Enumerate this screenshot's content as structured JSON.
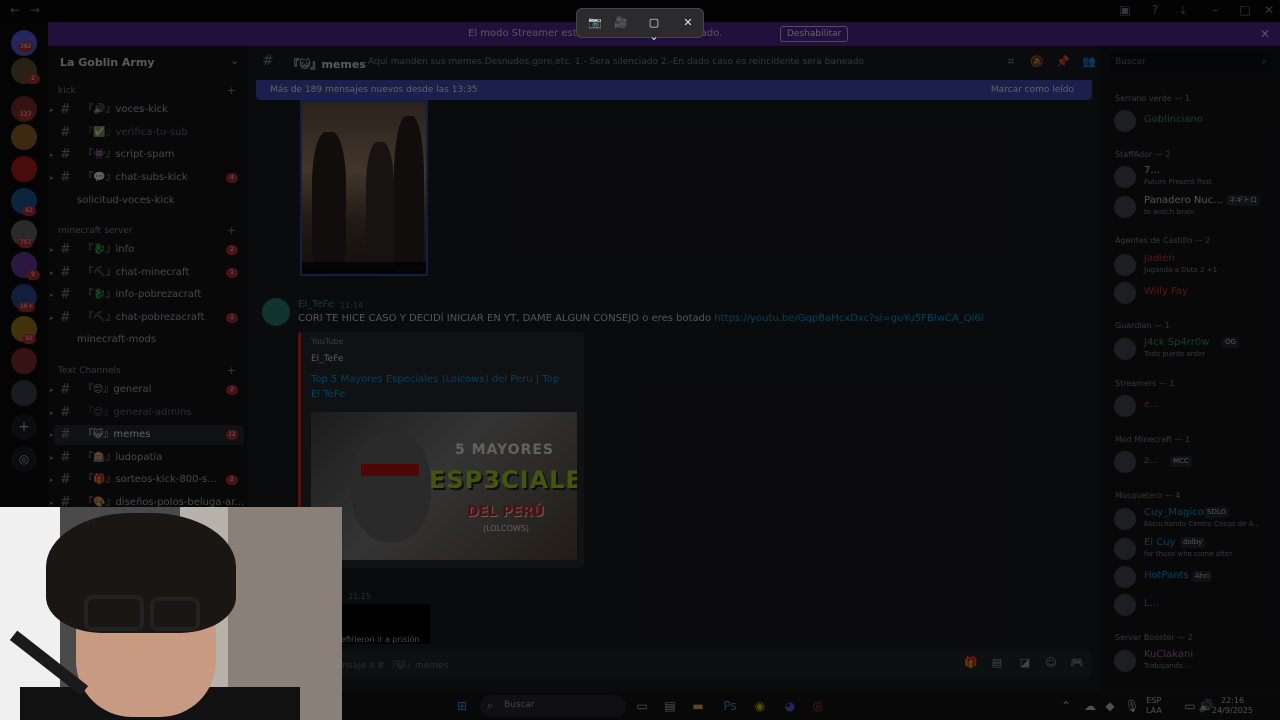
{
  "banner": {
    "text_left": "El modo Streamer está hab",
    "text_right": "se han truncado.",
    "button": "Deshabilitar",
    "close": "✕"
  },
  "snip": {
    "camera": "📷",
    "video": "🎥",
    "mode": "▢ ⌄",
    "close": "✕"
  },
  "rail": {
    "badges": [
      "382",
      "2",
      "127",
      "",
      "",
      "",
      "62",
      "707",
      "9",
      "1K+",
      "92",
      "",
      ""
    ]
  },
  "server": {
    "name": "La Goblin Army",
    "dropdown": "⌄"
  },
  "categories": {
    "kick": "kick",
    "minecraft": "minecraft server",
    "text": "Text Channels",
    "collapse": "›",
    "plus": "+"
  },
  "channels": [
    {
      "name": "『🔊』voces-kick",
      "count": ""
    },
    {
      "name": "『✅』verifica-tu-sub",
      "count": ""
    },
    {
      "name": "『👾』script-spam",
      "count": ""
    },
    {
      "name": "『💬』chat-subs-kick",
      "count": "4"
    },
    {
      "name": "solicitud-voces-kick",
      "count": ""
    },
    {
      "name": "『🐉』info",
      "count": "2"
    },
    {
      "name": "『⛏』chat-minecraft",
      "count": "1"
    },
    {
      "name": "『🐉』info-pobrezacraft",
      "count": "1"
    },
    {
      "name": "『⛏』chat-pobrezacraft",
      "count": "1"
    },
    {
      "name": "minecraft-mods",
      "count": ""
    },
    {
      "name": "『😊』general",
      "count": "2"
    },
    {
      "name": "『😊』general-admins",
      "count": ""
    },
    {
      "name": "『😺』memes",
      "count": "12"
    },
    {
      "name": "『🎰』ludopatia",
      "count": ""
    },
    {
      "name": "『🎁』sorteos-kick-800-s...",
      "count": "2"
    },
    {
      "name": "『🎨』diseños-polos-beluga-ar...",
      "count": ""
    }
  ],
  "header": {
    "channel": "『😺』memes",
    "topic": "Aqui manden sus memes.Desnudos,gore,etc. 1.- Sera silenciado 2.-En dado caso es reincidente sera baneado",
    "search_placeholder": "Buscar"
  },
  "new_messages": {
    "text": "Más de 189 mensajes nuevos desde las 13:35",
    "action": "Marcar como leído"
  },
  "message": {
    "author": "El_TeFe",
    "time": "21:14",
    "text": "CORI TE HICE CASO Y DECIDÍ INICIAR EN YT, DAME ALGUN CONSEJO o eres botado ",
    "link": "https://youtu.be/GqpBaHcxDxc?si=guYu5FBIwCA_Qi6l",
    "embed": {
      "provider": "YouTube",
      "author": "El_TeFe",
      "title": "Top 5 Mayores Especiales (Lolcows) del Peru | Top El TeFe",
      "thumb_line1": "5 MAYORES",
      "thumb_line2": "ESP3CIALES",
      "thumb_line3": "DEL PERÚ",
      "thumb_line4": "(LOLCOWS)"
    }
  },
  "message2": {
    "time": "21:15",
    "text": "efirieron ir a prisión"
  },
  "composer": {
    "placeholder": "nsaje a # 『😺』memes"
  },
  "members": [
    {
      "role": "Serrano verde — 1",
      "items": [
        {
          "name": "Goblinciano",
          "status": "",
          "color": "#3ba55d",
          "tag": ""
        }
      ]
    },
    {
      "role": "StaffAdor — 2",
      "items": [
        {
          "name": "7...",
          "status": "Future Present Past",
          "color": "#dcddde",
          "tag": ""
        },
        {
          "name": "Panadero Nuc...",
          "status": "to watch brain",
          "color": "#dcddde",
          "tag": "ネギトロ"
        }
      ]
    },
    {
      "role": "Agentes de Castillo — 2",
      "items": [
        {
          "name": "Jadien",
          "status": "Jugando a Dota 2 +1",
          "color": "#e03c3c",
          "tag": ""
        },
        {
          "name": "Willy Fay",
          "status": "",
          "color": "#e03c3c",
          "tag": ""
        }
      ]
    },
    {
      "role": "Guardian — 1",
      "items": [
        {
          "name": "J4ck Sp4rr0w",
          "status": "Todo puede arder",
          "color": "#3ba55d",
          "tag": "OG"
        }
      ]
    },
    {
      "role": "Streamers — 1",
      "items": [
        {
          "name": "e...",
          "status": "",
          "color": "#e03c3c",
          "tag": ""
        }
      ]
    },
    {
      "role": "Mod Minecraft — 1",
      "items": [
        {
          "name": "z...",
          "status": "",
          "color": "#3ba55d",
          "tag": "MCC"
        }
      ]
    },
    {
      "role": "Mosquetero — 4",
      "items": [
        {
          "name": "Cuy_Magico",
          "status": "Escuchando Centro Cosqo de A...",
          "color": "#00a8fc",
          "tag": "SDLG"
        },
        {
          "name": "El Cuy",
          "status": "for those who come after",
          "color": "#00a8fc",
          "tag": "dolby"
        },
        {
          "name": "HotPants",
          "status": "",
          "color": "#00a8fc",
          "tag": "Ahri"
        },
        {
          "name": "L...",
          "status": "",
          "color": "#00a8fc",
          "tag": ""
        }
      ]
    },
    {
      "role": "Server Booster — 2",
      "items": [
        {
          "name": "KuClakani",
          "status": "Trabajando...",
          "color": "#d65fd6",
          "tag": ""
        }
      ]
    }
  ],
  "taskbar": {
    "search": "Buscar",
    "lang1": "ESP",
    "lang2": "LAA",
    "time": "22:16",
    "date": "24/9/2025"
  }
}
